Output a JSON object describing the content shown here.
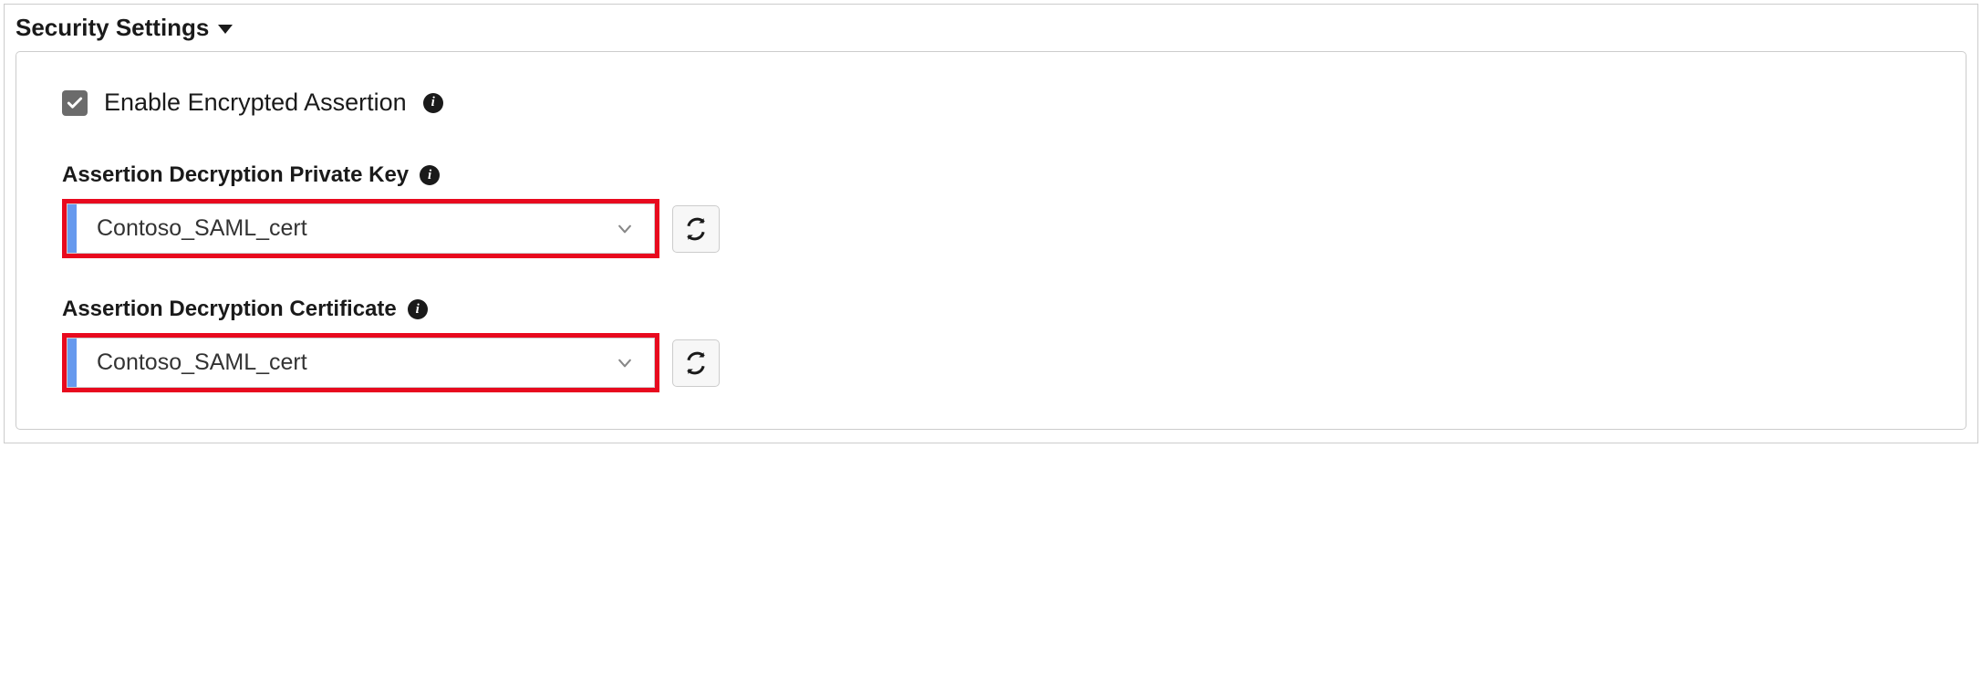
{
  "section": {
    "title": "Security Settings"
  },
  "checkbox": {
    "enable_encrypted_assertion": {
      "label": "Enable Encrypted Assertion",
      "checked": true
    }
  },
  "fields": {
    "private_key": {
      "label": "Assertion Decryption Private Key",
      "value": "Contoso_SAML_cert"
    },
    "certificate": {
      "label": "Assertion Decryption Certificate",
      "value": "Contoso_SAML_cert"
    }
  }
}
